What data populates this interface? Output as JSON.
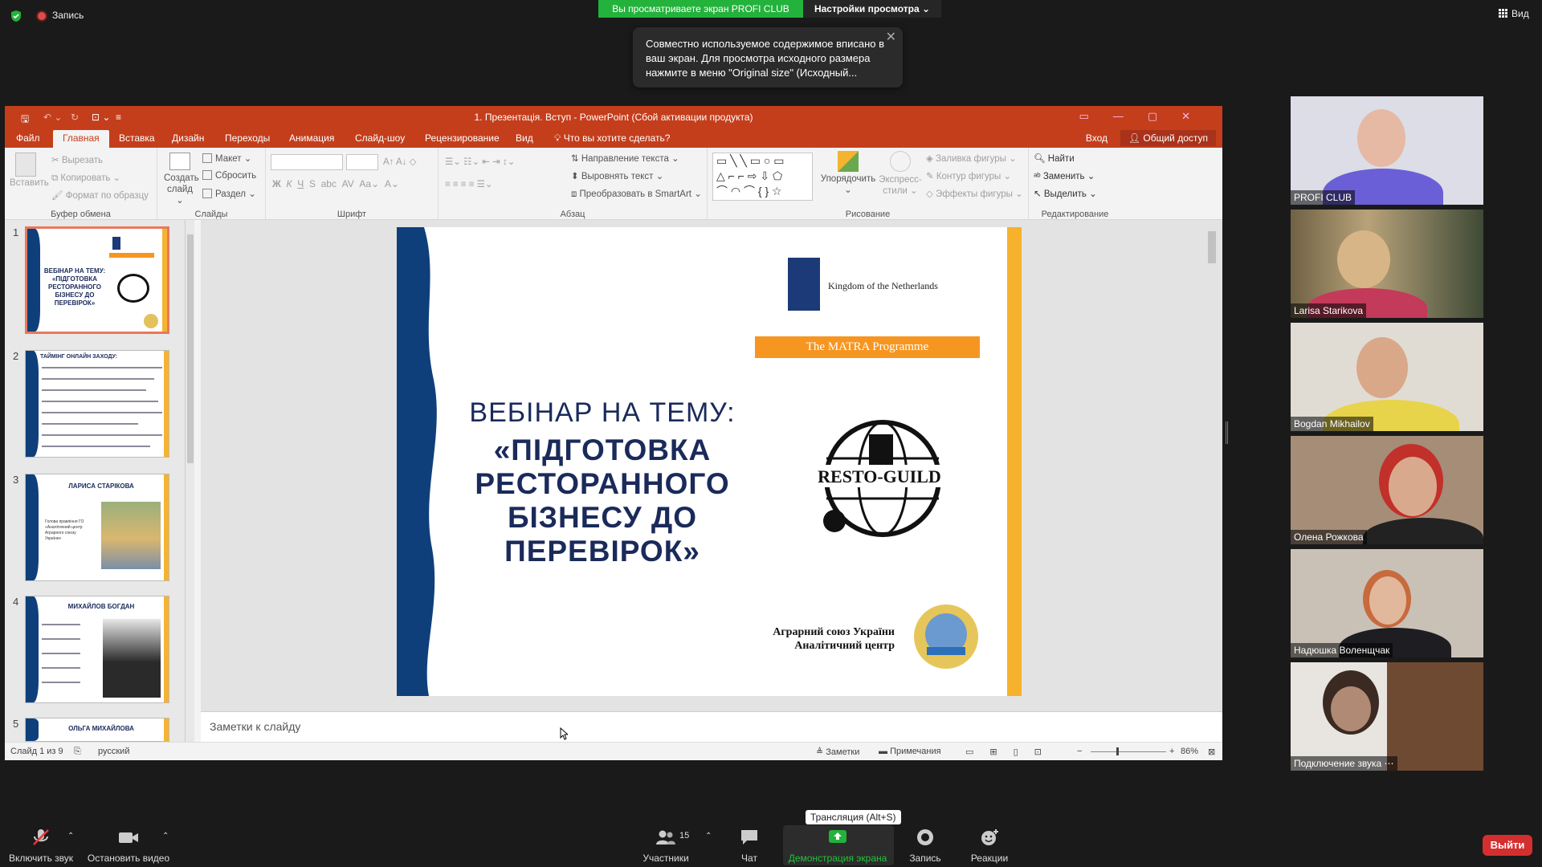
{
  "top": {
    "record_label": "Запись",
    "share_banner": "Вы просматриваете экран PROFI CLUB",
    "view_settings": "Настройки просмотра ⌄",
    "view_button": "Вид",
    "tooltip": "Совместно используемое содержимое вписано в ваш экран. Для просмотра исходного размера нажмите в меню \"Original size\" (Исходный..."
  },
  "ppt": {
    "title": "1. Презентація. Вступ - PowerPoint (Сбой активации продукта)",
    "tabs": [
      "Файл",
      "Главная",
      "Вставка",
      "Дизайн",
      "Переходы",
      "Анимация",
      "Слайд-шоу",
      "Рецензирование",
      "Вид"
    ],
    "tell_me": "Что вы хотите сделать?",
    "sign_in": "Вход",
    "share": "Общий доступ",
    "ribbon": {
      "clipboard": {
        "label": "Буфер обмена",
        "paste": "Вставить",
        "cut": "Вырезать",
        "copy": "Копировать",
        "format": "Формат по образцу"
      },
      "slides": {
        "label": "Слайды",
        "new": "Создать слайд",
        "layout": "Макет",
        "reset": "Сбросить",
        "section": "Раздел"
      },
      "font": {
        "label": "Шрифт"
      },
      "paragraph": {
        "label": "Абзац",
        "text_dir": "Направление текста",
        "align_text": "Выровнять текст",
        "smartart": "Преобразовать в SmartArt"
      },
      "drawing": {
        "label": "Рисование",
        "arrange": "Упорядочить",
        "quick_styles": "Экспресс-стили",
        "fill": "Заливка фигуры",
        "outline": "Контур фигуры",
        "effects": "Эффекты фигуры"
      },
      "editing": {
        "label": "Редактирование",
        "find": "Найти",
        "replace": "Заменить",
        "select": "Выделить"
      }
    },
    "thumbs": [
      {
        "num": "1",
        "title": "ВЕБІНАР НА ТЕМУ: «ПІДГОТОВКА РЕСТОРАННОГО БІЗНЕСУ ДО ПЕРЕВІРОК»"
      },
      {
        "num": "2",
        "title": "ТАЙМІНГ ОНЛАЙН ЗАХОДУ:"
      },
      {
        "num": "3",
        "title": "ЛАРИСА СТАРІКОВА",
        "text": "Голова правління ГО «Аналітичний центр Аграрного союзу України»"
      },
      {
        "num": "4",
        "title": "МИХАЙЛОВ БОГДАН"
      },
      {
        "num": "5",
        "title": "ОЛЬГА МИХАЙЛОВА"
      }
    ],
    "slide": {
      "nl_text": "Kingdom of the Netherlands",
      "matra": "The MATRA Programme",
      "line1": "ВЕБІНАР НА ТЕМУ:",
      "line2": "«ПІДГОТОВКА",
      "line3": "РЕСТОРАННОГО",
      "line4": "БІЗНЕСУ ДО",
      "line5": "ПЕРЕВІРОК»",
      "resto": "RESTO-GUILD",
      "agro1": "Аграрний союз України",
      "agro2": "Аналітичний центр"
    },
    "notes_placeholder": "Заметки к слайду",
    "status": {
      "slide": "Слайд 1 из 9",
      "lang": "русский",
      "notes": "Заметки",
      "comments": "Примечания",
      "zoom": "86%"
    }
  },
  "participants": [
    {
      "name": "PROFI CLUB"
    },
    {
      "name": "Larisa Starikova"
    },
    {
      "name": "Bogdan Mikhailov"
    },
    {
      "name": "Олена Рожкова"
    },
    {
      "name": "Надюшка Воленщчак"
    },
    {
      "name": "Подключение звука ⋯"
    }
  ],
  "bottom": {
    "unmute": "Включить звук",
    "stop_video": "Остановить видео",
    "participants": "Участники",
    "participants_count": "15",
    "chat": "Чат",
    "share": "Демонстрация экрана",
    "record": "Запись",
    "reactions": "Реакции",
    "tooltip": "Трансляция (Alt+S)",
    "leave": "Выйти"
  },
  "colors": {
    "ppt_accent": "#c43e1c",
    "zoom_green": "#23b23b",
    "leave_red": "#d32f2f",
    "slide_navy": "#0f3f7a",
    "slide_yellow": "#f6b22c"
  }
}
